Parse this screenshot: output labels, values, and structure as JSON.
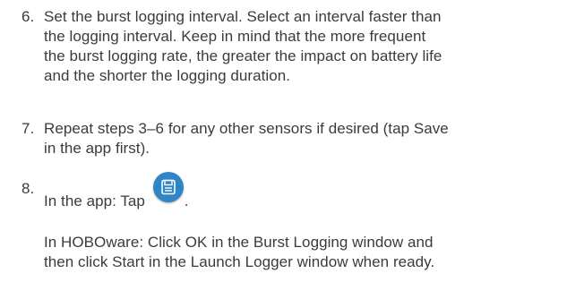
{
  "steps": [
    {
      "number": "6.",
      "lines": [
        "Set the burst logging interval. Select an interval faster than",
        "the logging interval. Keep in mind that the more frequent",
        "the burst logging rate, the greater the impact on battery life",
        "and the shorter the logging duration."
      ]
    },
    {
      "number": "7.",
      "lines": [
        "Repeat steps 3–6 for any other sensors if desired (tap Save",
        "in the app first)."
      ]
    },
    {
      "number": "8.",
      "prefix": "In the app: Tap",
      "suffix": ".",
      "icon": "save-icon",
      "note_lines": [
        "In HOBOware: Click OK in the Burst Logging window and",
        "then click Start in the Launch Logger window when ready."
      ]
    }
  ],
  "colors": {
    "text": "#3b3b3b",
    "icon_background": "#2f86c6",
    "icon_glyph": "#ffffff"
  }
}
